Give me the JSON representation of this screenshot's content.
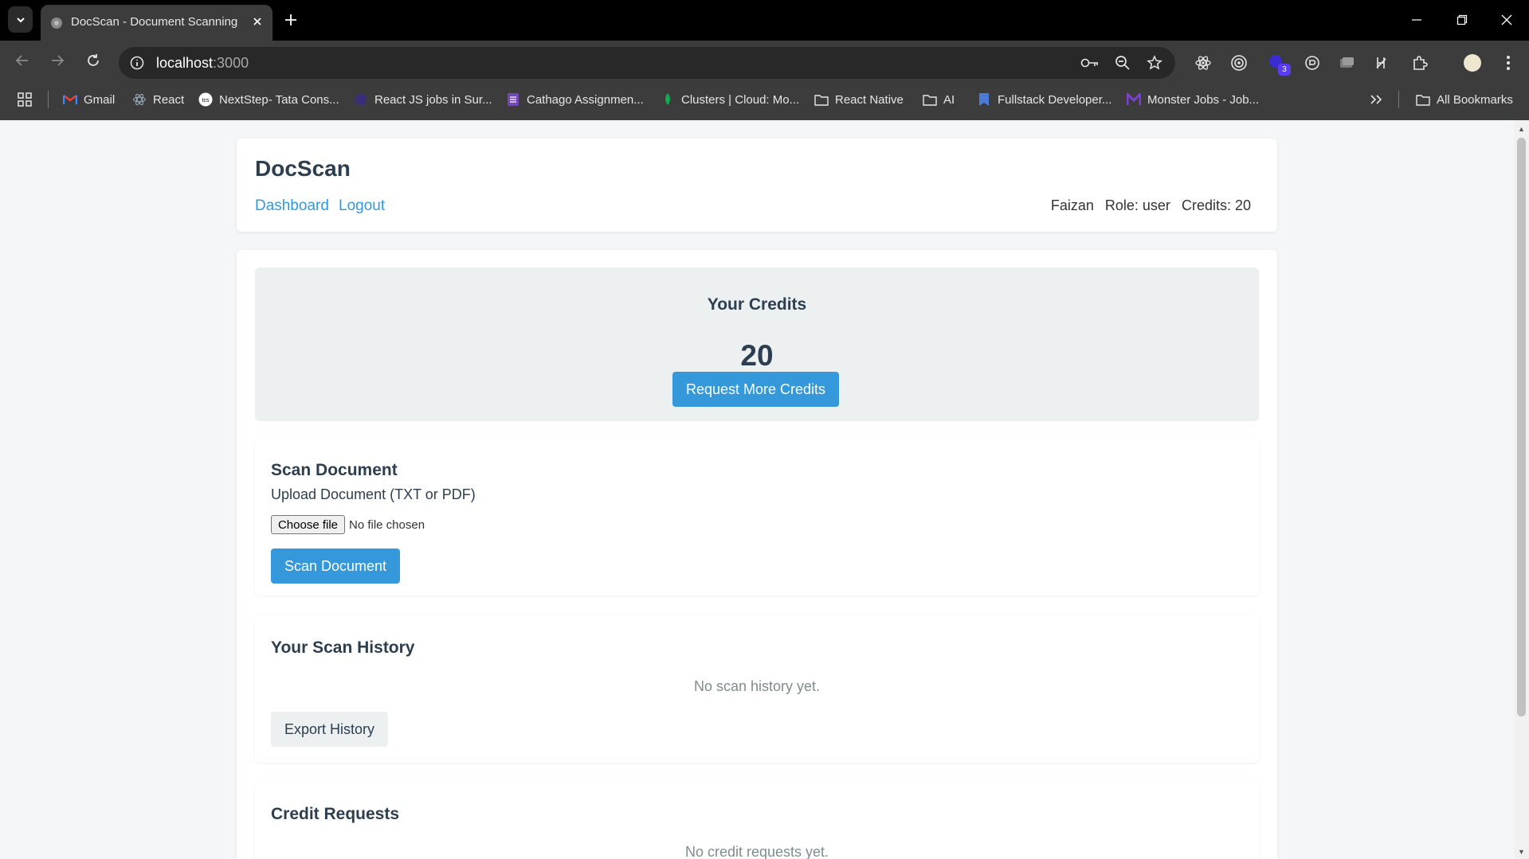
{
  "browser": {
    "tab_title": "DocScan - Document Scanning",
    "url_host": "localhost",
    "url_port": ":3000",
    "bookmarks": [
      {
        "label": "Gmail",
        "icon": "gmail-icon"
      },
      {
        "label": "React",
        "icon": "react-icon"
      },
      {
        "label": "NextStep- Tata Cons...",
        "icon": "tcs-icon"
      },
      {
        "label": "React JS jobs in Sur...",
        "icon": "jobs-icon"
      },
      {
        "label": "Cathago Assignmen...",
        "icon": "form-icon"
      },
      {
        "label": "Clusters | Cloud: Mo...",
        "icon": "mongodb-icon"
      },
      {
        "label": "React Native",
        "icon": "folder-icon"
      },
      {
        "label": "AI",
        "icon": "folder-icon"
      },
      {
        "label": "Fullstack Developer...",
        "icon": "bookmark-icon"
      },
      {
        "label": "Monster Jobs - Job...",
        "icon": "monster-icon"
      }
    ],
    "all_bookmarks": "All Bookmarks",
    "extension_badge": "3"
  },
  "header": {
    "brand": "DocScan",
    "nav": {
      "dashboard": "Dashboard",
      "logout": "Logout"
    },
    "user": {
      "name": "Faizan",
      "role": "Role: user",
      "credits": "Credits: 20"
    }
  },
  "credits": {
    "title": "Your Credits",
    "value": "20",
    "request_button": "Request More Credits"
  },
  "scan": {
    "title": "Scan Document",
    "upload_label": "Upload Document (TXT or PDF)",
    "choose_file": "Choose file",
    "file_status": "No file chosen",
    "scan_button": "Scan Document"
  },
  "history": {
    "title": "Your Scan History",
    "empty": "No scan history yet.",
    "export_button": "Export History"
  },
  "requests": {
    "title": "Credit Requests",
    "empty": "No credit requests yet."
  },
  "colors": {
    "accent": "#3498db",
    "heading": "#2c3e50",
    "panel": "#ecf0f1",
    "muted": "#7f8c8d"
  }
}
